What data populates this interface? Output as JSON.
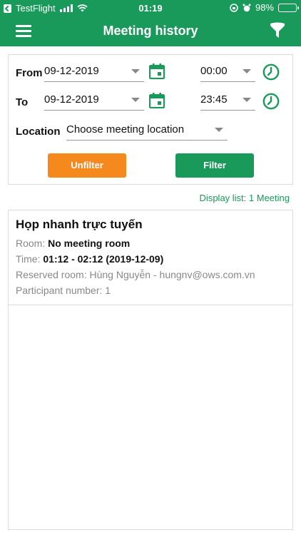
{
  "status_bar": {
    "carrier": "TestFlight",
    "time": "01:19",
    "battery": "98%",
    "battery_level": 0.98
  },
  "header": {
    "title": "Meeting history",
    "menu_icon": "hamburger-icon",
    "filter_icon": "filter-funnel-icon"
  },
  "filter": {
    "from_label": "From",
    "from_date": "09-12-2019",
    "from_time": "00:00",
    "to_label": "To",
    "to_date": "09-12-2019",
    "to_time": "23:45",
    "location_label": "Location",
    "location_value": "Choose meeting location",
    "unfilter_label": "Unfilter",
    "filter_label": "Filter"
  },
  "display_list": "Display list: 1 Meeting",
  "meetings": [
    {
      "title": "Họp nhanh trực tuyến",
      "room_label": "Room:",
      "room_value": "No meeting room",
      "time_label": "Time:",
      "time_value": "01:12 - 02:12 (2019-12-09)",
      "reserved_label": "Reserved room:",
      "reserved_value": "Hùng Nguyễn - hungnv@ows.com.vn",
      "participant_label": "Participant number:",
      "participant_value": "1"
    }
  ],
  "colors": {
    "primary": "#1a9a5a",
    "accent": "#f5891e"
  }
}
